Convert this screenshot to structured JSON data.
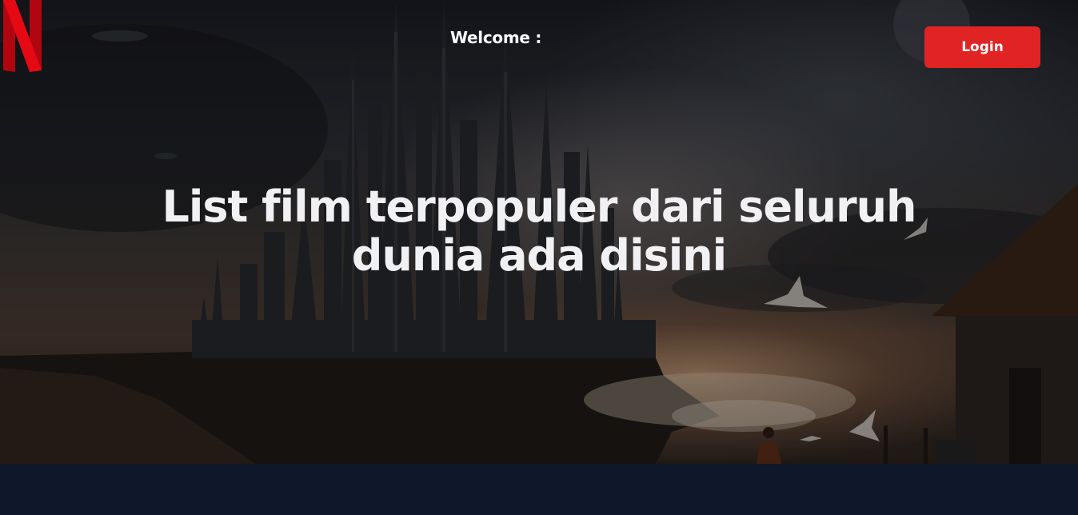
{
  "header": {
    "logo_name": "netflix-logo",
    "welcome_text": "Welcome :",
    "login_label": "Login"
  },
  "hero": {
    "headline": "List film terpopuler dari seluruh dunia ada disini"
  },
  "colors": {
    "brand_red": "#e02424",
    "logo_red": "#e50914",
    "footer_bg": "#0f172a",
    "text": "#ffffff"
  }
}
